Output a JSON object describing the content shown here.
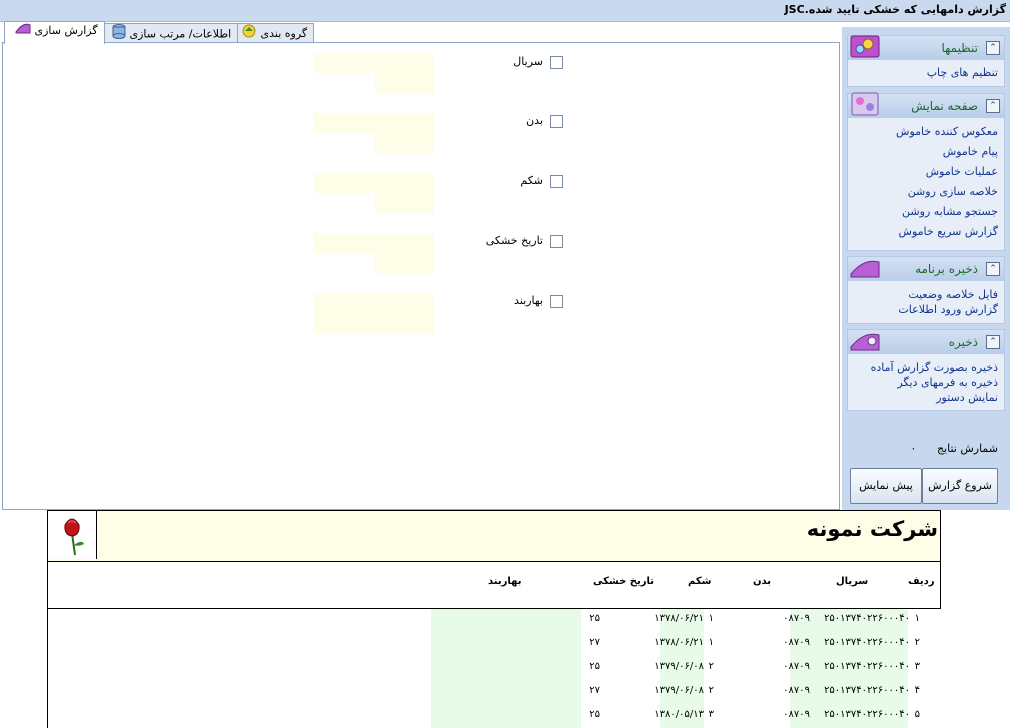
{
  "window": {
    "title": "گزارش دامهایی که خشکی تایید شده.JSC"
  },
  "tabs": [
    {
      "label": "گزارش سازی"
    },
    {
      "label": "اطلاعات/ مرتب سازی"
    },
    {
      "label": "گروه بندی"
    }
  ],
  "fields": [
    {
      "label": "سریال"
    },
    {
      "label": "بدن"
    },
    {
      "label": "شکم"
    },
    {
      "label": "تاریخ خشکی"
    },
    {
      "label": "بهاربند"
    }
  ],
  "sidebar": {
    "settings": {
      "title": "تنظیمها",
      "links": [
        "تنظیم های چاپ"
      ]
    },
    "display": {
      "title": "صفحه نمایش",
      "links": [
        "معکوس کننده خاموش",
        "پیام خاموش",
        "عملیات خاموش",
        "خلاصه سازی روشن",
        "جستجو مشابه روشن",
        "گزارش سریع خاموش"
      ]
    },
    "save_program": {
      "title": "ذخیره برنامه",
      "links": [
        "فایل خلاصه وضعیت",
        "گزارش ورود اطلاعات"
      ]
    },
    "save": {
      "title": "ذخیره",
      "links": [
        "ذخیره بصورت گزارش آماده",
        "ذخیره به فرمهای دیگر",
        "نمایش دستور"
      ]
    },
    "result_count_label": "شمارش نتایج",
    "result_count_value": "۰",
    "start_button": "شروع گزارش",
    "preview_button": "پیش نمایش"
  },
  "report": {
    "company": "شرکت نمونه",
    "columns": [
      "ردیف",
      "سریال",
      "بدن",
      "شکم",
      "تاریخ خشکی",
      "بهاربند"
    ],
    "rows": [
      {
        "row": "۱",
        "serial": "۲۵۰۱۳۷۴۰۲۲۶۰۰۰۴۰",
        "body": "۰۸۷۰۹",
        "belly": "۱",
        "date": "۱۳۷۸/۰۶/۲۱",
        "pen": "۲۵"
      },
      {
        "row": "۲",
        "serial": "۲۵۰۱۳۷۴۰۲۲۶۰۰۰۴۰",
        "body": "۰۸۷۰۹",
        "belly": "۱",
        "date": "۱۳۷۸/۰۶/۲۱",
        "pen": "۲۷"
      },
      {
        "row": "۳",
        "serial": "۲۵۰۱۳۷۴۰۲۲۶۰۰۰۴۰",
        "body": "۰۸۷۰۹",
        "belly": "۲",
        "date": "۱۳۷۹/۰۶/۰۸",
        "pen": "۲۵"
      },
      {
        "row": "۴",
        "serial": "۲۵۰۱۳۷۴۰۲۲۶۰۰۰۴۰",
        "body": "۰۸۷۰۹",
        "belly": "۲",
        "date": "۱۳۷۹/۰۶/۰۸",
        "pen": "۲۷"
      },
      {
        "row": "۵",
        "serial": "۲۵۰۱۳۷۴۰۲۲۶۰۰۰۴۰",
        "body": "۰۸۷۰۹",
        "belly": "۳",
        "date": "۱۳۸۰/۰۵/۱۳",
        "pen": "۲۵"
      }
    ]
  }
}
